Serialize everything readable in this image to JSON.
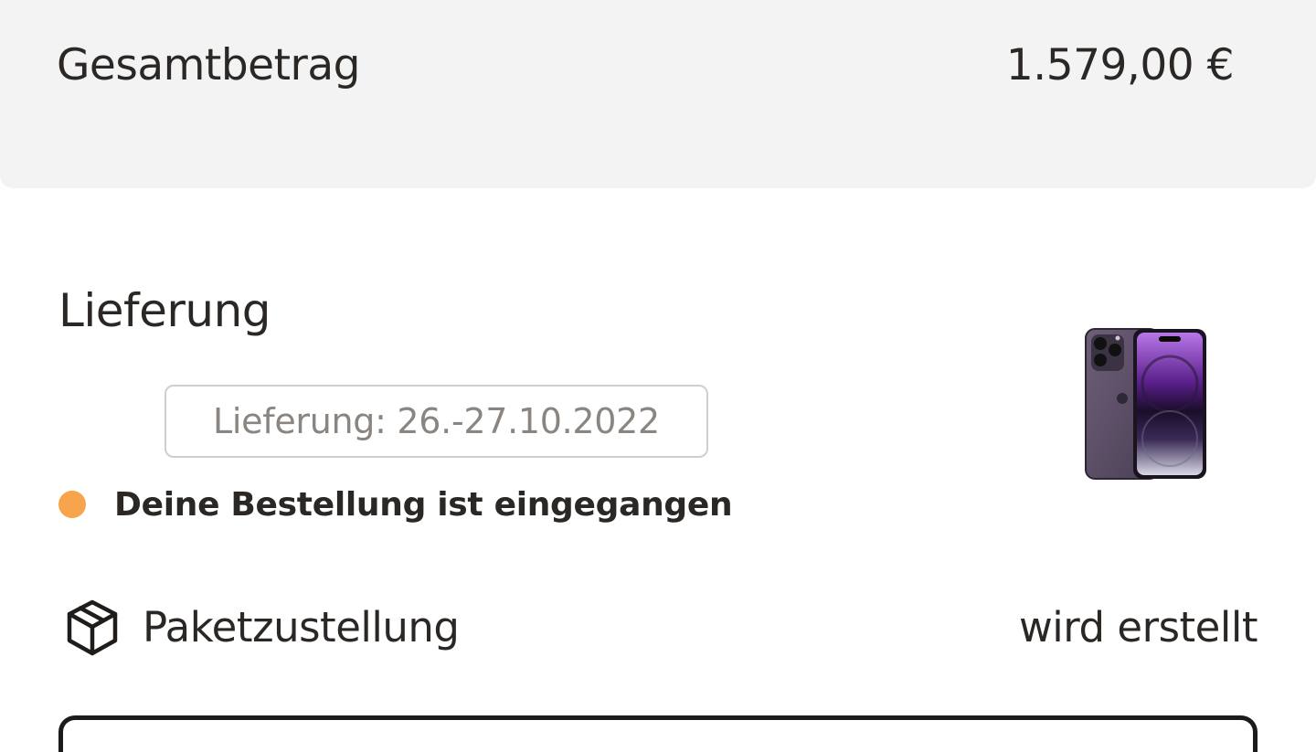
{
  "summary": {
    "total_label": "Gesamtbetrag",
    "total_value": "1.579,00 €"
  },
  "delivery": {
    "title": "Lieferung",
    "date_box": "Lieferung: 26.-27.10.2022",
    "status": {
      "text": "Deine Bestellung ist eingegangen",
      "dot_color": "#f8a44c"
    },
    "product_icon": "smartphone-product-image"
  },
  "package": {
    "icon": "package-box-icon",
    "label": "Paketzustellung",
    "status": "wird erstellt"
  }
}
